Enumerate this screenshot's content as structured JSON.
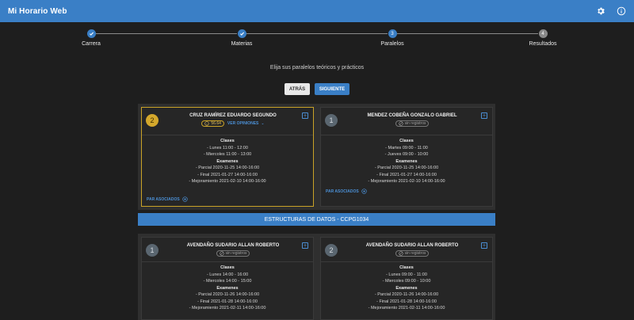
{
  "app": {
    "title": "Mi Horario Web"
  },
  "header_icons": [
    "settings-icon",
    "info-icon"
  ],
  "colors": {
    "primary": "#3a7fc6",
    "selected": "#c9a227",
    "completed_step": "#3a7fc6",
    "pending_step": "#8a8a8a"
  },
  "stepper": {
    "steps": [
      {
        "label": "Carrera",
        "status": "completed",
        "number": "1"
      },
      {
        "label": "Materias",
        "status": "completed",
        "number": "2"
      },
      {
        "label": "Paralelos",
        "status": "active",
        "number": "3"
      },
      {
        "label": "Resultados",
        "status": "pending",
        "number": "4"
      }
    ]
  },
  "instructions": "Elija sus paralelos teóricos y prácticos",
  "buttons": {
    "back": "ATRÁS",
    "next": "SIGUIENTE"
  },
  "subjects": [
    {
      "name": "",
      "cards": [
        {
          "parallel": "2",
          "selected": true,
          "teacher": "CRUZ RAMÍREZ EDUARDO SEGUNDO",
          "rating": "56.64",
          "opinions_label": "VER OPINIONES",
          "classes_header": "Clases",
          "classes": [
            "- Lunes 11:00 - 12:00",
            "- Miercoles 11:00 - 13:00"
          ],
          "exams_header": "Examenes",
          "exams": [
            "- Parcial 2020-11-25 14:00-16:00",
            "- Final 2021-01-27 14:00-16:00",
            "- Mejoramiento 2021-02-10 14:00-16:00"
          ],
          "paired_label": "PAR ASOCIADOS"
        },
        {
          "parallel": "1",
          "selected": false,
          "teacher": "MENDEZ COBEÑA GONZALO GABRIEL",
          "rating": "sin registros",
          "classes_header": "Clases",
          "classes": [
            "- Martes 09:00 - 11:00",
            "- Jueves 09:00 - 10:00"
          ],
          "exams_header": "Examenes",
          "exams": [
            "- Parcial 2020-11-25 14:00-16:00",
            "- Final 2021-01-27 14:00-16:00",
            "- Mejoramiento 2021-02-10 14:00-16:00"
          ],
          "paired_label": "PAR ASOCIADOS"
        }
      ]
    },
    {
      "name": "ESTRUCTURAS DE DATOS - CCPG1034",
      "cards": [
        {
          "parallel": "1",
          "selected": false,
          "teacher": "AVENDAÑO SUDARIO ALLAN ROBERTO",
          "rating": "sin registros",
          "classes_header": "Clases",
          "classes": [
            "- Lunes 14:00 - 16:00",
            "- Miercoles 14:00 - 15:00"
          ],
          "exams_header": "Examenes",
          "exams": [
            "- Parcial 2020-11-26 14:00-16:00",
            "- Final 2021-01-28 14:00-16:00",
            "- Mejoramiento 2021-02-11 14:00-16:00"
          ]
        },
        {
          "parallel": "2",
          "selected": false,
          "teacher": "AVENDAÑO SUDARIO ALLAN ROBERTO",
          "rating": "sin registros",
          "classes_header": "Clases",
          "classes": [
            "- Lunes 09:00 - 11:00",
            "- Miercoles 09:00 - 10:00"
          ],
          "exams_header": "Examenes",
          "exams": [
            "- Parcial 2020-11-26 14:00-16:00",
            "- Final 2021-01-28 14:00-16:00",
            "- Mejoramiento 2021-02-11 14:00-16:00"
          ]
        }
      ]
    }
  ]
}
